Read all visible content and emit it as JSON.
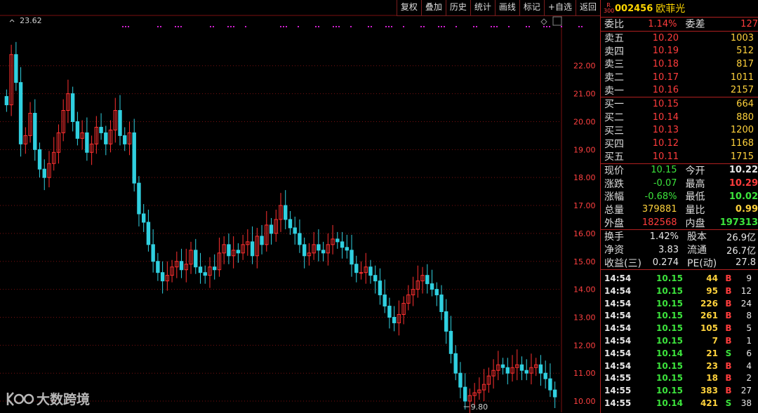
{
  "toolbar": [
    "复权",
    "叠加",
    "历史",
    "统计",
    "画线",
    "标记",
    "+自选",
    "返回"
  ],
  "stock": {
    "badge_r": "R",
    "badge_300": "300",
    "code": "002456",
    "name": "欧菲光"
  },
  "weibi": {
    "label": "委比",
    "value": "1.14%",
    "label2": "委差",
    "value2": "127"
  },
  "asks": [
    {
      "label": "卖五",
      "price": "10.20",
      "vol": "1003"
    },
    {
      "label": "卖四",
      "price": "10.19",
      "vol": "512"
    },
    {
      "label": "卖三",
      "price": "10.18",
      "vol": "817"
    },
    {
      "label": "卖二",
      "price": "10.17",
      "vol": "1011"
    },
    {
      "label": "卖一",
      "price": "10.16",
      "vol": "2157"
    }
  ],
  "bids": [
    {
      "label": "买一",
      "price": "10.15",
      "vol": "664"
    },
    {
      "label": "买二",
      "price": "10.14",
      "vol": "880"
    },
    {
      "label": "买三",
      "price": "10.13",
      "vol": "1200"
    },
    {
      "label": "买四",
      "price": "10.12",
      "vol": "1168"
    },
    {
      "label": "买五",
      "price": "10.11",
      "vol": "1715"
    }
  ],
  "quote": [
    {
      "l1": "现价",
      "v1": "10.15",
      "c1": "grn",
      "l2": "今开",
      "v2": "10.22",
      "c2": "wht"
    },
    {
      "l1": "涨跌",
      "v1": "-0.07",
      "c1": "grn",
      "l2": "最高",
      "v2": "10.29",
      "c2": "red"
    },
    {
      "l1": "涨幅",
      "v1": "-0.68%",
      "c1": "grn",
      "l2": "最低",
      "v2": "10.02",
      "c2": "grn"
    },
    {
      "l1": "总量",
      "v1": "379881",
      "c1": "yel",
      "l2": "量比",
      "v2": "0.99",
      "c2": "yel"
    },
    {
      "l1": "外盘",
      "v1": "182568",
      "c1": "red",
      "l2": "内盘",
      "v2": "197313",
      "c2": "grn"
    }
  ],
  "fin": [
    {
      "l1": "换手",
      "v1": "1.42%",
      "l2": "股本",
      "v2": "26.9亿"
    },
    {
      "l1": "净资",
      "v1": "3.83",
      "l2": "流通",
      "v2": "26.7亿"
    },
    {
      "l1": "收益(三)",
      "v1": "0.274",
      "l2": "PE(动)",
      "v2": "27.8"
    }
  ],
  "ticks": [
    {
      "t": "14:54",
      "p": "10.15",
      "v": "44",
      "d": "B",
      "n": "9"
    },
    {
      "t": "14:54",
      "p": "10.15",
      "v": "95",
      "d": "B",
      "n": "12"
    },
    {
      "t": "14:54",
      "p": "10.15",
      "v": "226",
      "d": "B",
      "n": "24"
    },
    {
      "t": "14:54",
      "p": "10.15",
      "v": "261",
      "d": "B",
      "n": "8"
    },
    {
      "t": "14:54",
      "p": "10.15",
      "v": "105",
      "d": "B",
      "n": "5"
    },
    {
      "t": "14:54",
      "p": "10.15",
      "v": "7",
      "d": "B",
      "n": "1"
    },
    {
      "t": "14:54",
      "p": "10.14",
      "v": "21",
      "d": "S",
      "n": "6"
    },
    {
      "t": "14:54",
      "p": "10.15",
      "v": "23",
      "d": "B",
      "n": "4"
    },
    {
      "t": "14:55",
      "p": "10.15",
      "v": "18",
      "d": "B",
      "n": "2"
    },
    {
      "t": "14:55",
      "p": "10.15",
      "v": "383",
      "d": "B",
      "n": "27"
    },
    {
      "t": "14:55",
      "p": "10.14",
      "v": "421",
      "d": "S",
      "n": "38"
    }
  ],
  "watermark": "大数跨境",
  "chart_data": {
    "type": "candlestick",
    "y_ticks": [
      "22.00",
      "21.00",
      "20.00",
      "19.00",
      "18.00",
      "17.00",
      "16.00",
      "15.00",
      "14.00",
      "13.00",
      "12.00",
      "11.00",
      "10.00"
    ],
    "ylim": [
      9.6,
      23.9
    ],
    "max_label": "23.62",
    "min_label": "9.80",
    "colors": {
      "up": "#ff3030",
      "down": "#30d0e0",
      "grid": "#7a1010",
      "marker": "#d020d0"
    },
    "closes": [
      20.6,
      22.4,
      21.4,
      19.2,
      19.5,
      20.3,
      19.0,
      18.3,
      18.0,
      18.5,
      18.9,
      19.6,
      20.4,
      21.0,
      20.0,
      19.4,
      19.6,
      18.9,
      19.2,
      19.8,
      19.6,
      19.2,
      19.7,
      20.4,
      19.5,
      19.2,
      19.6,
      17.8,
      16.7,
      16.4,
      15.6,
      15.0,
      14.6,
      14.3,
      14.5,
      14.8,
      15.0,
      14.7,
      14.9,
      15.4,
      14.8,
      14.6,
      14.5,
      14.8,
      14.7,
      15.3,
      15.6,
      15.2,
      15.4,
      15.3,
      15.6,
      15.7,
      15.2,
      15.9,
      15.6,
      16.3,
      16.0,
      16.5,
      17.0,
      16.5,
      16.2,
      16.0,
      15.6,
      15.2,
      15.3,
      15.6,
      15.4,
      15.3,
      15.6,
      15.8,
      15.7,
      15.5,
      15.4,
      14.9,
      14.6,
      14.6,
      14.8,
      14.5,
      14.3,
      13.8,
      13.4,
      13.0,
      12.8,
      13.1,
      13.5,
      13.8,
      14.0,
      14.3,
      14.5,
      14.2,
      14.0,
      13.8,
      13.2,
      12.5,
      11.7,
      11.0,
      10.5,
      10.0,
      10.2,
      10.3,
      10.4,
      10.6,
      10.9,
      11.1,
      11.3,
      11.2,
      11.0,
      11.2,
      11.3,
      11.1,
      11.0,
      11.2,
      11.3,
      11.0,
      10.8,
      10.4,
      10.15
    ],
    "marker_groups": [
      5,
      7,
      8,
      10,
      11,
      12,
      14,
      15,
      16,
      17,
      18,
      19,
      20,
      21,
      22,
      23,
      24,
      25,
      26,
      27,
      28,
      29,
      30,
      31
    ]
  }
}
